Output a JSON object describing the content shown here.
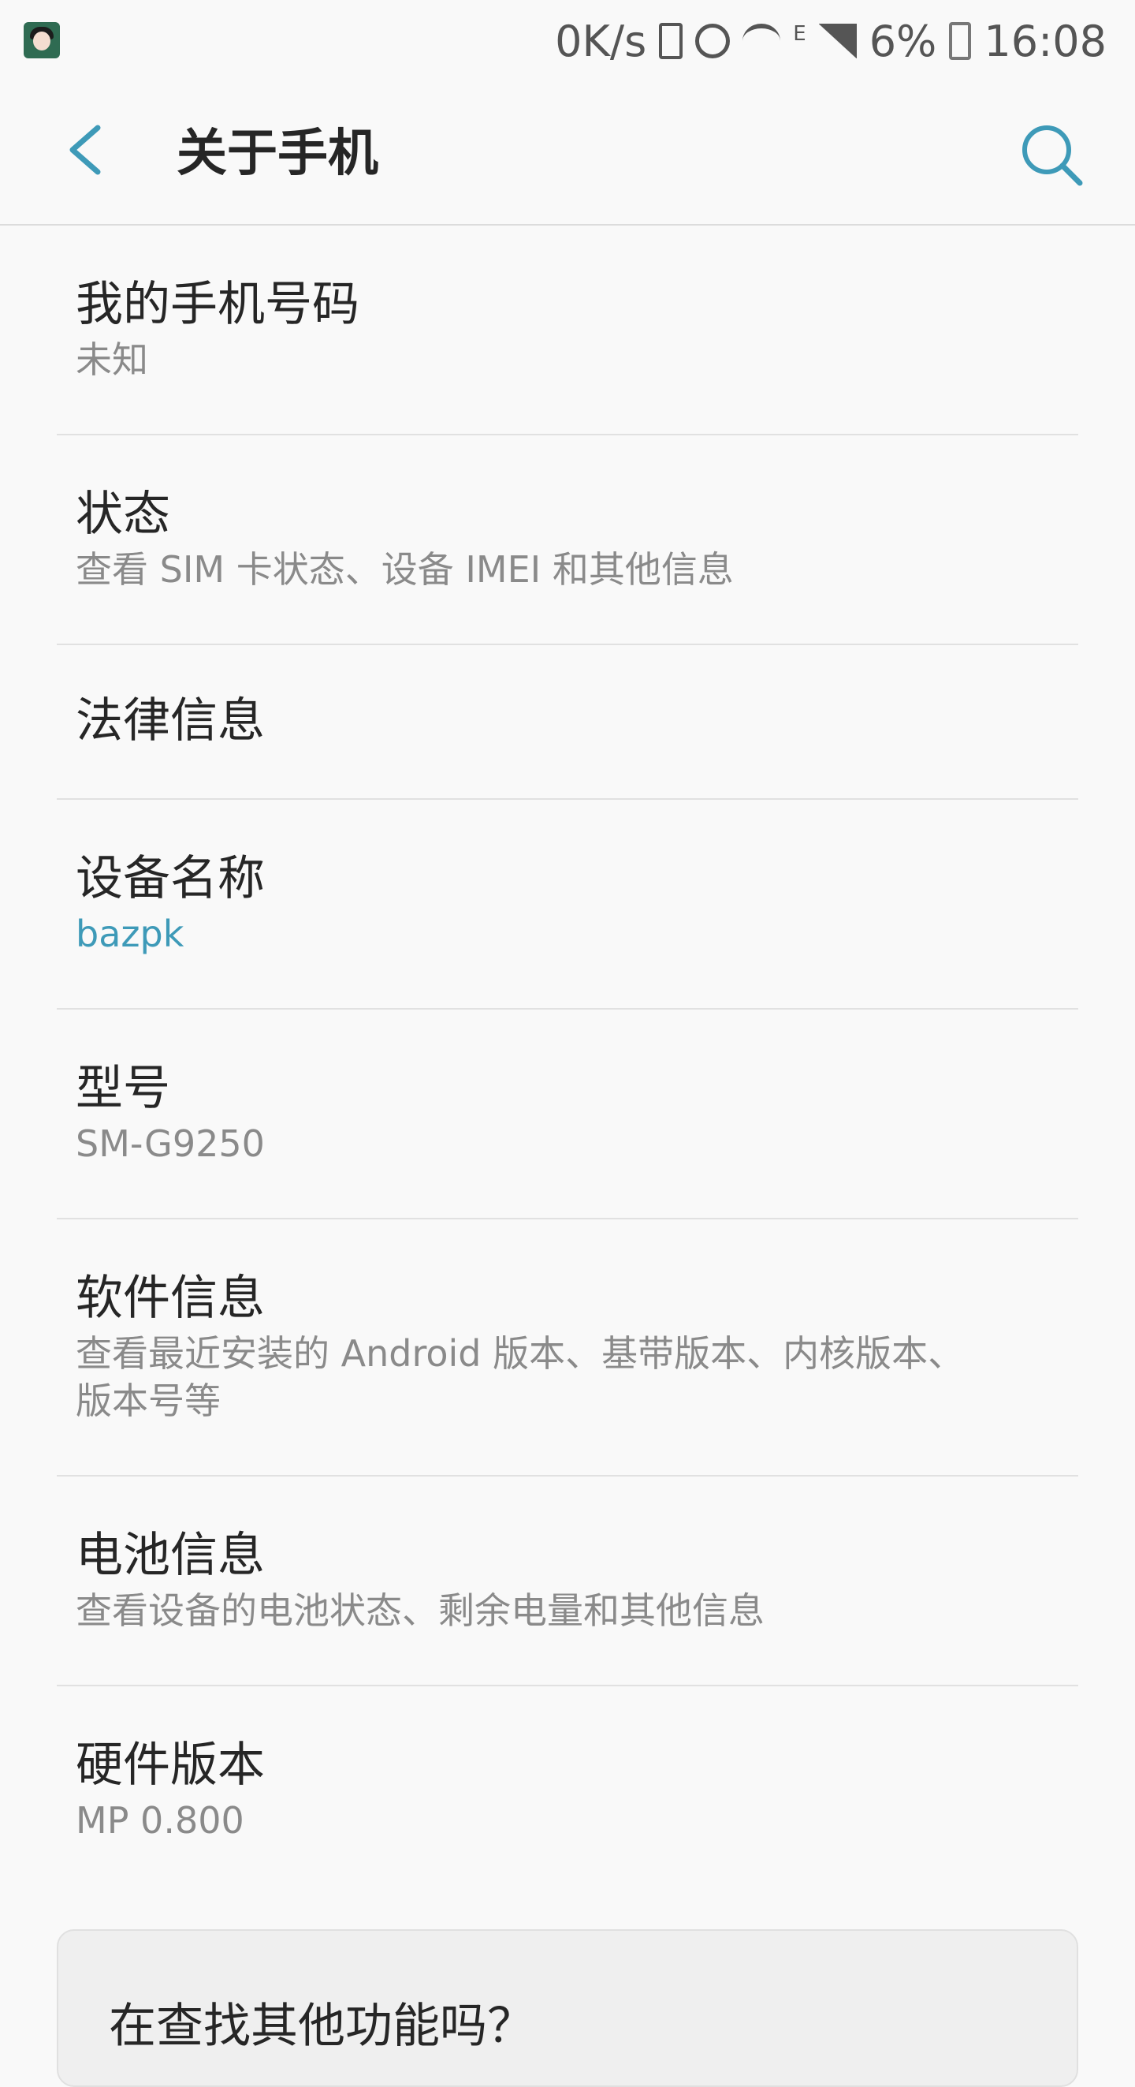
{
  "status_bar": {
    "net_speed": "0K/s",
    "network_type": "E",
    "battery_percent": "6%",
    "time": "16:08"
  },
  "toolbar": {
    "title": "关于手机",
    "back_icon": "back-arrow-icon",
    "search_icon": "search-icon",
    "accent_color": "#3e9ab8"
  },
  "items": [
    {
      "title": "我的手机号码",
      "summary": "未知"
    },
    {
      "title": "状态",
      "summary": "查看 SIM 卡状态、设备 IMEI 和其他信息"
    },
    {
      "title": "法律信息"
    },
    {
      "title": "设备名称",
      "summary": "bazpk"
    },
    {
      "title": "型号",
      "summary": "SM-G9250"
    },
    {
      "title": "软件信息",
      "summary_line1": "查看最近安装的 Android 版本、基带版本、内核版本、",
      "summary_line2": "版本号等"
    },
    {
      "title": "电池信息",
      "summary": "查看设备的电池状态、剩余电量和其他信息"
    },
    {
      "title": "硬件版本",
      "summary": "MP 0.800"
    }
  ],
  "suggest_card": {
    "title": "在查找其他功能吗？"
  }
}
